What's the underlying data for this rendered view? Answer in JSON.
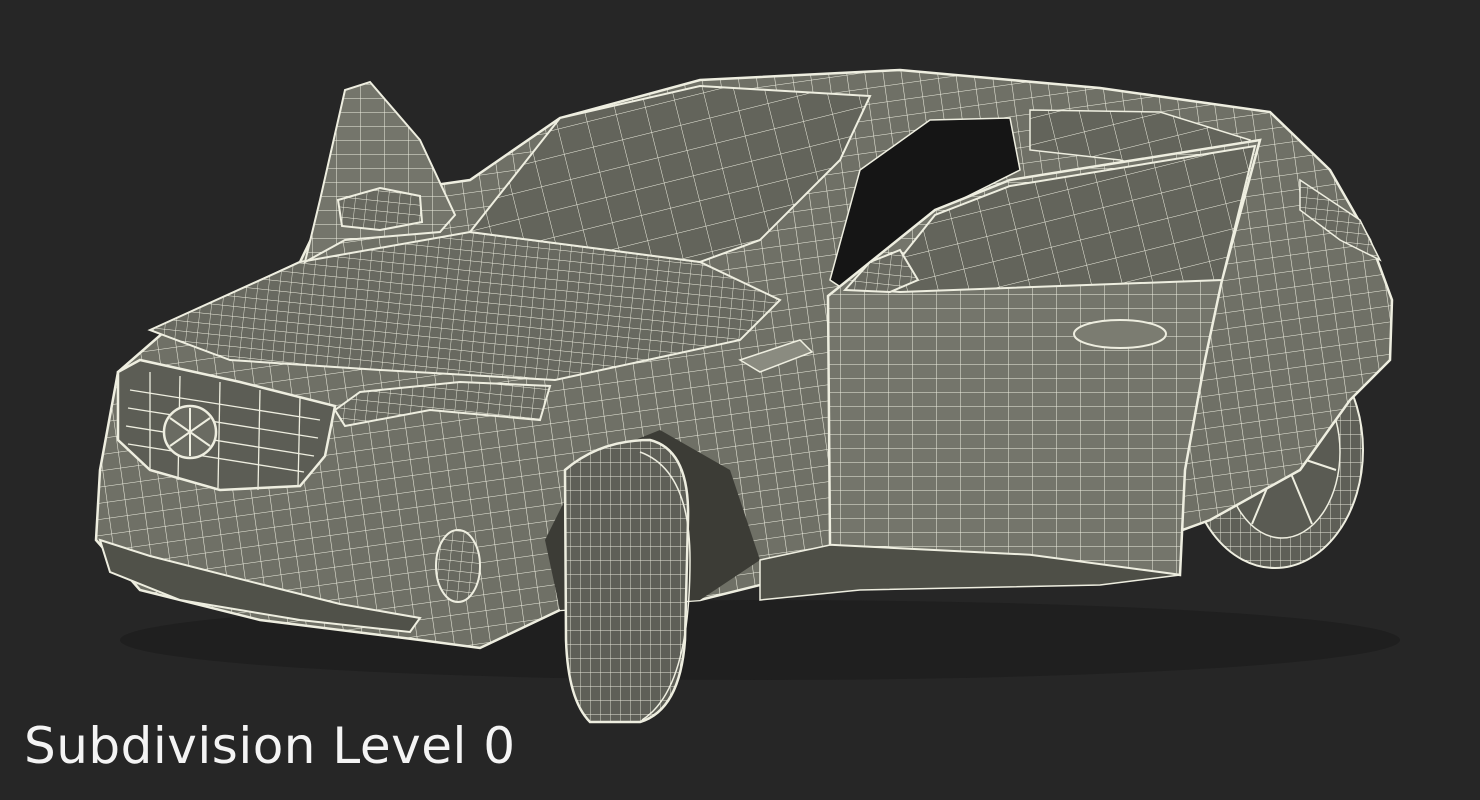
{
  "caption": {
    "text": "Subdivision Level 0"
  },
  "render": {
    "subject": "wireframe-suv-doors-open",
    "background_color": "#262626",
    "surface_color": "#6f7066",
    "wire_color": "#eeeee0",
    "shadow_color": "#3c3c36"
  }
}
